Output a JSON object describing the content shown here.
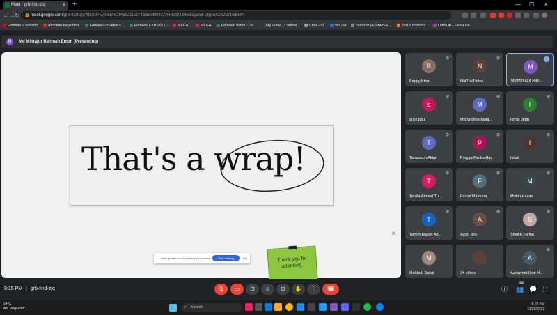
{
  "browser": {
    "tab_title": "Meet - grb-find-zjq",
    "tab_close": "×",
    "new_tab": "+",
    "window_controls": [
      "—",
      "☐",
      "×"
    ],
    "url_host": "meet.google.com",
    "url_path": "/grb-find-zjq?fbclid=IwAR1mCTh5lC11ezTTaI5hoMThCVHRa80UH6dicyamFDfpsoACxZW1wBHPI",
    "back": "←",
    "forward": "→",
    "reload": "↻"
  },
  "bookmarks": [
    {
      "label": "Formula 1 Streams",
      "color": "#e10600"
    },
    {
      "label": "Absolute Beginners...",
      "color": "#c0392b"
    },
    {
      "label": "Farewell 23 video s...",
      "color": "#1e8e3e"
    },
    {
      "label": "Farewell EXB 2021 -...",
      "color": "#1e8e3e"
    },
    {
      "label": "MEGA",
      "color": "#d9272e"
    },
    {
      "label": "MEGA",
      "color": "#d9272e"
    },
    {
      "label": "Farewell Video - Go...",
      "color": "#1e8e3e"
    },
    {
      "label": "My Home | Codeca...",
      "color": "#444"
    },
    {
      "label": "ChatGPT",
      "color": "#74aa9c"
    },
    {
      "label": "acc det",
      "color": "#1a73e8"
    },
    {
      "label": "codezaz (AZMAYEE...",
      "color": "#888"
    },
    {
      "label": "Just a moment...",
      "color": "#f38020"
    },
    {
      "label": "Luma AI - Fields Da...",
      "color": "#8e44ad"
    }
  ],
  "presenter": {
    "initial": "M",
    "label": "Md Mintajur Rahman Emon (Presenting)"
  },
  "slide": {
    "title": "That's a wrap!",
    "note": "Thank you for attending."
  },
  "share_bar": {
    "message": "meet.google.com is sharing your screen.",
    "stop_label": "Stop sharing",
    "hide_label": "Hide"
  },
  "participants": [
    {
      "name": "Bappy Khan",
      "initial": "B",
      "color": "#8d6e63",
      "muted": true
    },
    {
      "name": "NotTheTurbo",
      "initial": "N",
      "color": "#5d4037",
      "muted": true
    },
    {
      "name": "Md Mintajur Rah...",
      "initial": "M",
      "color": "#7e57c2",
      "muted": false,
      "active": true
    },
    {
      "name": "sristi paul",
      "initial": "s",
      "color": "#c2185b",
      "muted": true
    },
    {
      "name": "Md Shafkat Manj...",
      "initial": "M",
      "color": "#5c6bc0",
      "muted": true
    },
    {
      "name": "Ismat Jerin",
      "initial": "I",
      "color": "#2e7d32",
      "muted": true
    },
    {
      "name": "Tabassum Aktar",
      "initial": "T",
      "color": "#5c6bc0",
      "muted": true
    },
    {
      "name": "Progga Fariba Haq",
      "initial": "P",
      "color": "#ad1457",
      "muted": true
    },
    {
      "name": "Istiak",
      "initial": "I",
      "color": "#4e342e",
      "muted": true
    },
    {
      "name": "Tanjila Ahmed Tu...",
      "initial": "T",
      "color": "#d81b60",
      "muted": true
    },
    {
      "name": "Fairuz Mamuna",
      "initial": "F",
      "color": "#546e7a",
      "muted": true
    },
    {
      "name": "Mubin Hasan",
      "initial": "M",
      "color": "#37474f",
      "muted": true
    },
    {
      "name": "Tamim Hasan Ap...",
      "initial": "T",
      "color": "#1565c0",
      "muted": true
    },
    {
      "name": "Avizit Roy",
      "initial": "A",
      "color": "#6d4c41",
      "muted": true
    },
    {
      "name": "Sheikh Fariha",
      "initial": "S",
      "color": "#bcaaa4",
      "muted": true
    },
    {
      "name": "Mahbub Sahal",
      "initial": "M",
      "color": "#a1887f",
      "muted": false
    },
    {
      "name": "34 others",
      "initial": "",
      "color": "#5d4037",
      "muted": false
    },
    {
      "name": "Azmayeet Ibne H...",
      "initial": "A",
      "color": "#455a64",
      "muted": true
    }
  ],
  "meetbar": {
    "time": "9:15 PM",
    "separator": "|",
    "code": "grb-find-zjq",
    "participant_count": "50",
    "controls": [
      "mic-off",
      "camera-off",
      "captions",
      "emoji",
      "present",
      "raise-hand",
      "more",
      "end-call"
    ]
  },
  "taskbar": {
    "temperature": "24°C",
    "weather_text": "Air: Very Poor",
    "weather_badge": "1",
    "search_label": "Search",
    "time": "9:15 PM",
    "date": "11/26/2023"
  },
  "colors": {
    "accent": "#8ab4f8",
    "end_call": "#ea4335",
    "note": "#8dc63f"
  }
}
